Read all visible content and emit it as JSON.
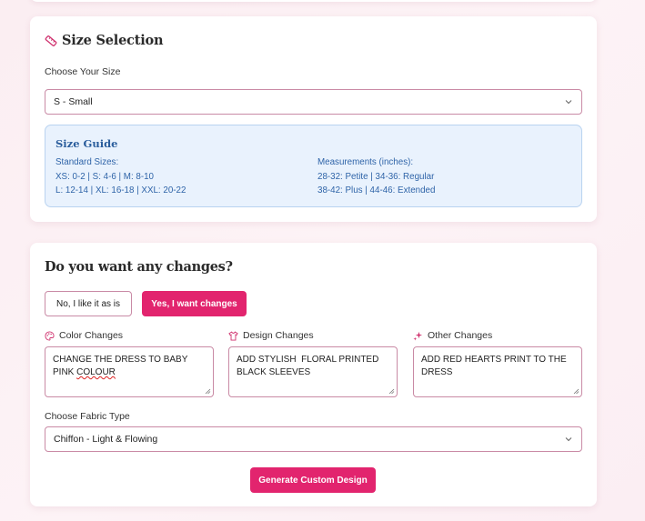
{
  "size_section": {
    "title": "Size Selection",
    "choose_label": "Choose Your Size",
    "selected_size": "S - Small",
    "guide": {
      "title": "Size Guide",
      "standard_heading": "Standard Sizes:",
      "standard_line1": "XS: 0-2 | S: 4-6 | M: 8-10",
      "standard_line2": "L: 12-14 | XL: 16-18 | XXL: 20-22",
      "measure_heading": "Measurements (inches):",
      "measure_line1": "28-32: Petite | 34-36: Regular",
      "measure_line2": "38-42: Plus | 44-46: Extended"
    }
  },
  "changes_section": {
    "title": "Do you want any changes?",
    "no_button": "No, I like it as is",
    "yes_button": "Yes, I want changes",
    "color": {
      "label": "Color Changes",
      "value_prefix": "CHANGE THE DRESS TO BABY\nPINK ",
      "value_misspelled": "COLOUR"
    },
    "design": {
      "label": "Design Changes",
      "value": "ADD STYLISH  FLORAL PRINTED\nBLACK SLEEVES"
    },
    "other": {
      "label": "Other Changes",
      "value": "ADD RED HEARTS PRINT TO THE\nDRESS"
    },
    "fabric_label": "Choose Fabric Type",
    "fabric_selected": "Chiffon - Light & Flowing",
    "generate_button": "Generate Custom Design"
  },
  "colors": {
    "accent_pink": "#e2246e",
    "border_pink": "#c98aa5",
    "guide_blue": "#2f64a8",
    "guide_bg": "#e9f2fd"
  },
  "icons": {
    "size_title": "tape-measure-icon",
    "color_label": "palette-icon",
    "design_label": "shirt-icon",
    "other_label": "sparkles-icon",
    "select_chevron": "chevron-down-icon"
  }
}
